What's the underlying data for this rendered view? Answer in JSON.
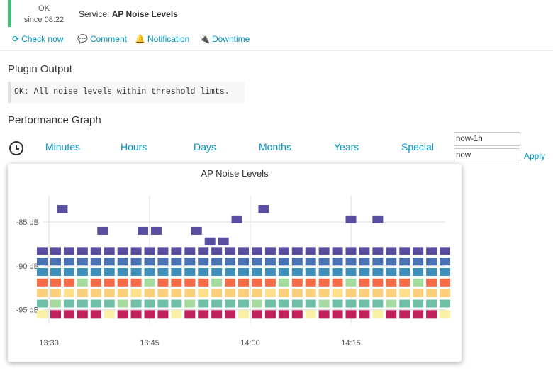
{
  "status": {
    "state": "OK",
    "since": "since 08:22",
    "color": "#44bb77"
  },
  "service": {
    "prefix": "Service:",
    "name": "AP Noise Levels"
  },
  "actions": [
    {
      "label": "Check now",
      "icon": "refresh-icon"
    },
    {
      "label": "Comment",
      "icon": "comment-icon"
    },
    {
      "label": "Notification",
      "icon": "bell-icon"
    },
    {
      "label": "Downtime",
      "icon": "plug-icon"
    }
  ],
  "plugin_output": {
    "heading": "Plugin Output",
    "text": "OK: All noise levels within threshold limts."
  },
  "perf": {
    "heading": "Performance Graph",
    "tabs": [
      "Minutes",
      "Hours",
      "Days",
      "Months",
      "Years",
      "Special"
    ],
    "from_value": "now-1h",
    "to_value": "now",
    "apply_label": "Apply"
  },
  "chart_data": {
    "type": "scatter",
    "title": "AP Noise Levels",
    "xlabel": "",
    "ylabel": "",
    "x_ticks": [
      "13:30",
      "13:45",
      "14:00",
      "14:15"
    ],
    "y_ticks": [
      "-85 dB",
      "-90 dB",
      "-95 dB"
    ],
    "ylim": [
      -96,
      -82
    ],
    "grid": true,
    "series": [
      {
        "color": "#5a4ea0",
        "points": [
          {
            "x": "13:32",
            "y": -83.5
          },
          {
            "x": "13:38",
            "y": -86
          },
          {
            "x": "13:44",
            "y": -86
          },
          {
            "x": "13:46",
            "y": -86
          },
          {
            "x": "13:52",
            "y": -86
          },
          {
            "x": "13:54",
            "y": -87.2
          },
          {
            "x": "13:56",
            "y": -87.2
          },
          {
            "x": "13:58",
            "y": -84.7
          },
          {
            "x": "14:02",
            "y": -83.5
          },
          {
            "x": "14:15",
            "y": -84.7
          },
          {
            "x": "14:19",
            "y": -84.7
          },
          {
            "x": "*",
            "y": -88.3
          }
        ]
      },
      {
        "color": "#4a72b2",
        "points": [
          {
            "x": "*",
            "y": -89.5
          }
        ]
      },
      {
        "color": "#3e8fba",
        "points": [
          {
            "x": "*",
            "y": -90.7
          }
        ]
      },
      {
        "color": "#f36d4a",
        "points": [
          {
            "x": "*",
            "y": -91.9
          }
        ]
      },
      {
        "color": "#fbd07c",
        "points": [
          {
            "x": "*",
            "y": -93.1
          }
        ]
      },
      {
        "color": "#6ebfa5",
        "points": [
          {
            "x": "*",
            "y": -94.3
          }
        ]
      },
      {
        "color": "#c0215a",
        "points": [
          {
            "x": "*",
            "y": -95.5
          }
        ]
      }
    ]
  }
}
